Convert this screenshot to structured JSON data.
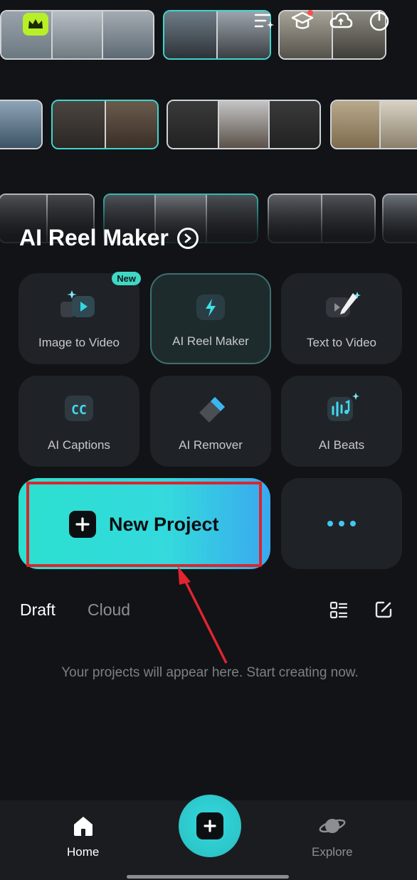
{
  "colors": {
    "accent": "#35d6dc",
    "annotation_red": "#d9262f",
    "background": "#121316"
  },
  "hero": {
    "title": "AI Reel Maker",
    "arrow_icon": "chevron-right-circle-icon"
  },
  "top_icons": [
    "menu-sparkle-icon",
    "graduation-cap-icon",
    "cloud-icon",
    "power-icon"
  ],
  "features": [
    {
      "label": "Image to Video",
      "badge": "New",
      "icon": "image-to-video-icon"
    },
    {
      "label": "AI Reel Maker",
      "icon": "lightning-icon"
    },
    {
      "label": "Text to Video",
      "icon": "text-to-video-icon"
    },
    {
      "label": "AI Captions",
      "icon": "captions-icon"
    },
    {
      "label": "AI Remover",
      "icon": "eraser-icon"
    },
    {
      "label": "AI Beats",
      "icon": "beats-icon"
    }
  ],
  "new_project": {
    "label": "New Project"
  },
  "tabs": {
    "draft": "Draft",
    "cloud": "Cloud"
  },
  "empty_state": "Your projects will appear here. Start creating now.",
  "nav": {
    "home": "Home",
    "explore": "Explore"
  }
}
